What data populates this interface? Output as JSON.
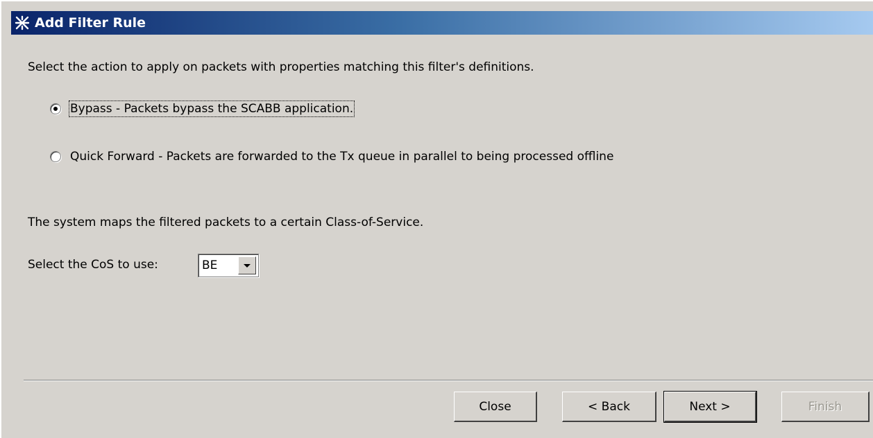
{
  "window": {
    "title": "Add Filter Rule",
    "icon": "cisco-network-icon"
  },
  "content": {
    "instruction": "Select the action to apply on packets with properties matching this filter's definitions.",
    "options": [
      {
        "label": "Bypass - Packets bypass the SCABB application.",
        "selected": true
      },
      {
        "label": "Quick Forward - Packets are forwarded to the Tx queue in parallel to being processed offline",
        "selected": false
      }
    ],
    "cos_description": "The system maps the filtered packets to a certain Class-of-Service.",
    "cos_label": "Select the CoS to use:",
    "cos_value": "BE"
  },
  "buttons": {
    "close": "Close",
    "back": "< Back",
    "next": "Next >",
    "finish": "Finish"
  }
}
